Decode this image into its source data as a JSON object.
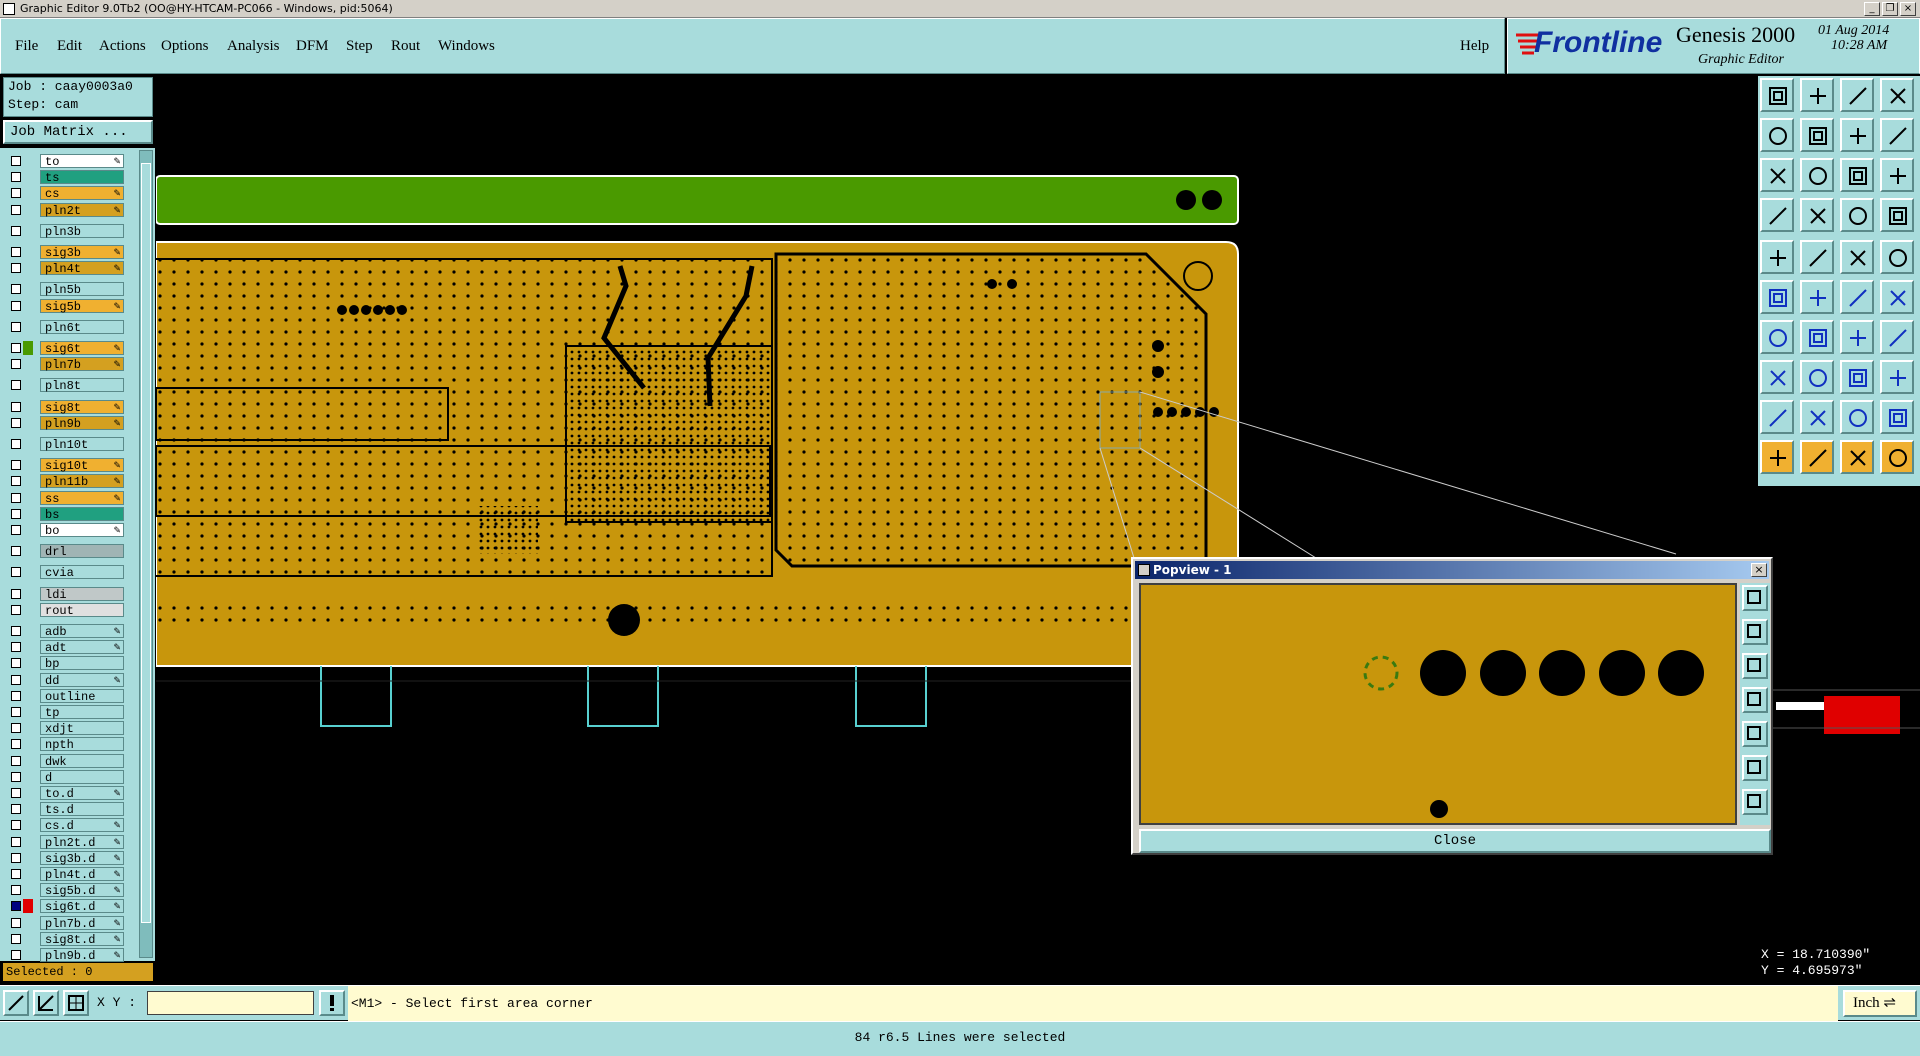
{
  "window": {
    "title": "Graphic Editor 9.0Tb2 (OO@HY-HTCAM-PC066 - Windows, pid:5064)"
  },
  "menu": {
    "items": [
      "File",
      "Edit",
      "Actions",
      "Options",
      "Analysis",
      "DFM",
      "Step",
      "Rout",
      "Windows"
    ],
    "help": "Help"
  },
  "brand": {
    "logo": "Frontline",
    "product": "Genesis 2000",
    "subtitle": "Graphic Editor",
    "date": "01 Aug 2014",
    "time": "10:28 AM"
  },
  "job": {
    "job_line": "Job : caay0003a0",
    "step_line": "Step: cam",
    "matrix_button": "Job Matrix ..."
  },
  "layers": [
    {
      "name": "to",
      "color": "#ffffff",
      "edit": true
    },
    {
      "name": "ts",
      "color": "#20a080",
      "edit": false
    },
    {
      "name": "cs",
      "color": "#f0b030",
      "edit": true
    },
    {
      "name": "pln2t",
      "color": "#d4a020",
      "edit": true
    },
    {
      "name": "pln3b",
      "color": "#a8dcdc",
      "edit": false
    },
    {
      "name": "sig3b",
      "color": "#f0b030",
      "edit": true
    },
    {
      "name": "pln4t",
      "color": "#d4a020",
      "edit": true
    },
    {
      "name": "pln5b",
      "color": "#a8dcdc",
      "edit": false
    },
    {
      "name": "sig5b",
      "color": "#f0b030",
      "edit": true
    },
    {
      "name": "pln6t",
      "color": "#a8dcdc",
      "edit": false
    },
    {
      "name": "sig6t",
      "color": "#f0b030",
      "edit": true
    },
    {
      "name": "pln7b",
      "color": "#d4a020",
      "edit": true
    },
    {
      "name": "pln8t",
      "color": "#a8dcdc",
      "edit": false
    },
    {
      "name": "sig8t",
      "color": "#f0b030",
      "edit": true
    },
    {
      "name": "pln9b",
      "color": "#d4a020",
      "edit": true
    },
    {
      "name": "pln10t",
      "color": "#a8dcdc",
      "edit": false
    },
    {
      "name": "sig10t",
      "color": "#f0b030",
      "edit": true
    },
    {
      "name": "pln11b",
      "color": "#d4a020",
      "edit": true
    },
    {
      "name": "ss",
      "color": "#f0b030",
      "edit": true
    },
    {
      "name": "bs",
      "color": "#20a080",
      "edit": false
    },
    {
      "name": "bo",
      "color": "#ffffff",
      "edit": true
    },
    {
      "name": "drl",
      "color": "#a0b4b4",
      "edit": false
    },
    {
      "name": "cvia",
      "color": "#a8dcdc",
      "edit": false
    },
    {
      "name": "ldi",
      "color": "#c0c8c8",
      "edit": false
    },
    {
      "name": "rout",
      "color": "#e0e0e0",
      "edit": false
    },
    {
      "name": "adb",
      "color": "#a8dcdc",
      "edit": true
    },
    {
      "name": "adt",
      "color": "#a8dcdc",
      "edit": true
    },
    {
      "name": "bp",
      "color": "#a8dcdc",
      "edit": false
    },
    {
      "name": "dd",
      "color": "#a8dcdc",
      "edit": true
    },
    {
      "name": "outline",
      "color": "#a8dcdc",
      "edit": false
    },
    {
      "name": "tp",
      "color": "#a8dcdc",
      "edit": false
    },
    {
      "name": "xdjt",
      "color": "#a8dcdc",
      "edit": false
    },
    {
      "name": "npth",
      "color": "#a8dcdc",
      "edit": false
    },
    {
      "name": "dwk",
      "color": "#a8dcdc",
      "edit": false
    },
    {
      "name": "d",
      "color": "#a8dcdc",
      "edit": false
    },
    {
      "name": "to.d",
      "color": "#a8dcdc",
      "edit": true
    },
    {
      "name": "ts.d",
      "color": "#a8dcdc",
      "edit": false
    },
    {
      "name": "cs.d",
      "color": "#a8dcdc",
      "edit": true
    },
    {
      "name": "pln2t.d",
      "color": "#a8dcdc",
      "edit": true
    },
    {
      "name": "sig3b.d",
      "color": "#a8dcdc",
      "edit": true
    },
    {
      "name": "pln4t.d",
      "color": "#a8dcdc",
      "edit": true
    },
    {
      "name": "sig5b.d",
      "color": "#a8dcdc",
      "edit": true
    },
    {
      "name": "sig6t.d",
      "color": "#a8dcdc",
      "edit": true,
      "active": true
    },
    {
      "name": "pln7b.d",
      "color": "#a8dcdc",
      "edit": true
    },
    {
      "name": "sig8t.d",
      "color": "#a8dcdc",
      "edit": true
    },
    {
      "name": "pln9b.d",
      "color": "#a8dcdc",
      "edit": true
    }
  ],
  "selected_label": "Selected : 0",
  "coords": {
    "x": "X = 18.710390\"",
    "y": "Y = 4.695973\""
  },
  "bottom": {
    "xy_label": "X Y :",
    "xy_value": "",
    "prompt": "<M1> - Select first area corner",
    "units": "Inch"
  },
  "status": "84 r6.5 Lines were selected",
  "popview": {
    "title": "Popview - 1",
    "close_label": "Close"
  },
  "colors": {
    "board": "#c8960c",
    "panel": "#a8dcdc",
    "accent": "#4a9a00",
    "highlight": "#e00000"
  }
}
